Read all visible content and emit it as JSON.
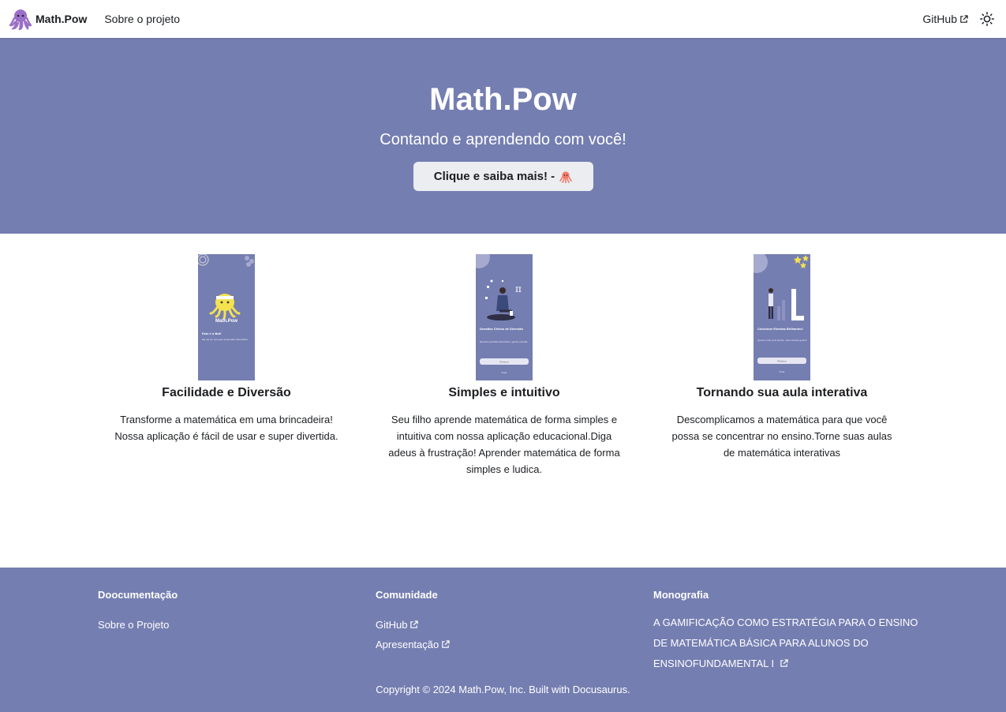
{
  "navbar": {
    "brand_title": "Math.Pow",
    "links": [
      {
        "label": "Sobre o projeto"
      }
    ],
    "right_links": [
      {
        "label": "GitHub"
      }
    ]
  },
  "hero": {
    "title": "Math.Pow",
    "subtitle": "Contando e aprendendo com você!",
    "button_label": "Clique e saiba mais! -"
  },
  "features": [
    {
      "title": "Facilidade e Diversão",
      "description": "Transforme a matemática em uma brincadeira! Nossa aplicação é fácil de usar e super divertida.",
      "screen": {
        "brand": "Math.Pow",
        "heading": "Este é o Bot!",
        "body": "Ele vai ser seu guia na jornada matemática"
      }
    },
    {
      "title": "Simples e intuitivo",
      "description": "Seu filho aprende matemática de forma simples e intuitiva com nossa aplicação educacional.Diga adeus à frustração! Aprender matemática de forma simples e ludica.",
      "screen": {
        "heading": "Desafios Cheios de Diversão",
        "body": "Resolva questões divertidas e ganhe estrelas",
        "button": "Próximo",
        "skip": "Pular"
      }
    },
    {
      "title": "Tornando sua aula interativa",
      "description": "Descomplicamos a matemática para que você possa se concentrar no ensino.Torne suas aulas de matemática interativas",
      "screen": {
        "heading": "Colecione Estrelas Brilhantes!",
        "body": "Quanto mais você acerta, mais estrelas ganha!",
        "button": "Próximo",
        "skip": "Pular"
      }
    }
  ],
  "footer": {
    "columns": [
      {
        "title": "Doocumentação",
        "links": [
          {
            "label": "Sobre o Projeto"
          }
        ]
      },
      {
        "title": "Comunidade",
        "links": [
          {
            "label": "GitHub"
          },
          {
            "label": "Apresentação"
          }
        ]
      },
      {
        "title": "Monografia",
        "text": "A GAMIFICAÇÃO COMO ESTRATÉGIA PARA O ENSINO DE MATEMÁTICA BÁSICA PARA ALUNOS DO ENSINOFUNDAMENTAL I"
      }
    ],
    "copyright": "Copyright © 2024 Math.Pow, Inc. Built with Docusaurus."
  },
  "colors": {
    "brand": "#757eb1",
    "octopus": "#9b6fc9",
    "bot": "#f4e24f",
    "button_bg": "#ebedf0",
    "text": "#1c1e21"
  },
  "icons": [
    "octopus-logo-icon",
    "external-link-icon",
    "sun-icon",
    "octopus-icon"
  ]
}
